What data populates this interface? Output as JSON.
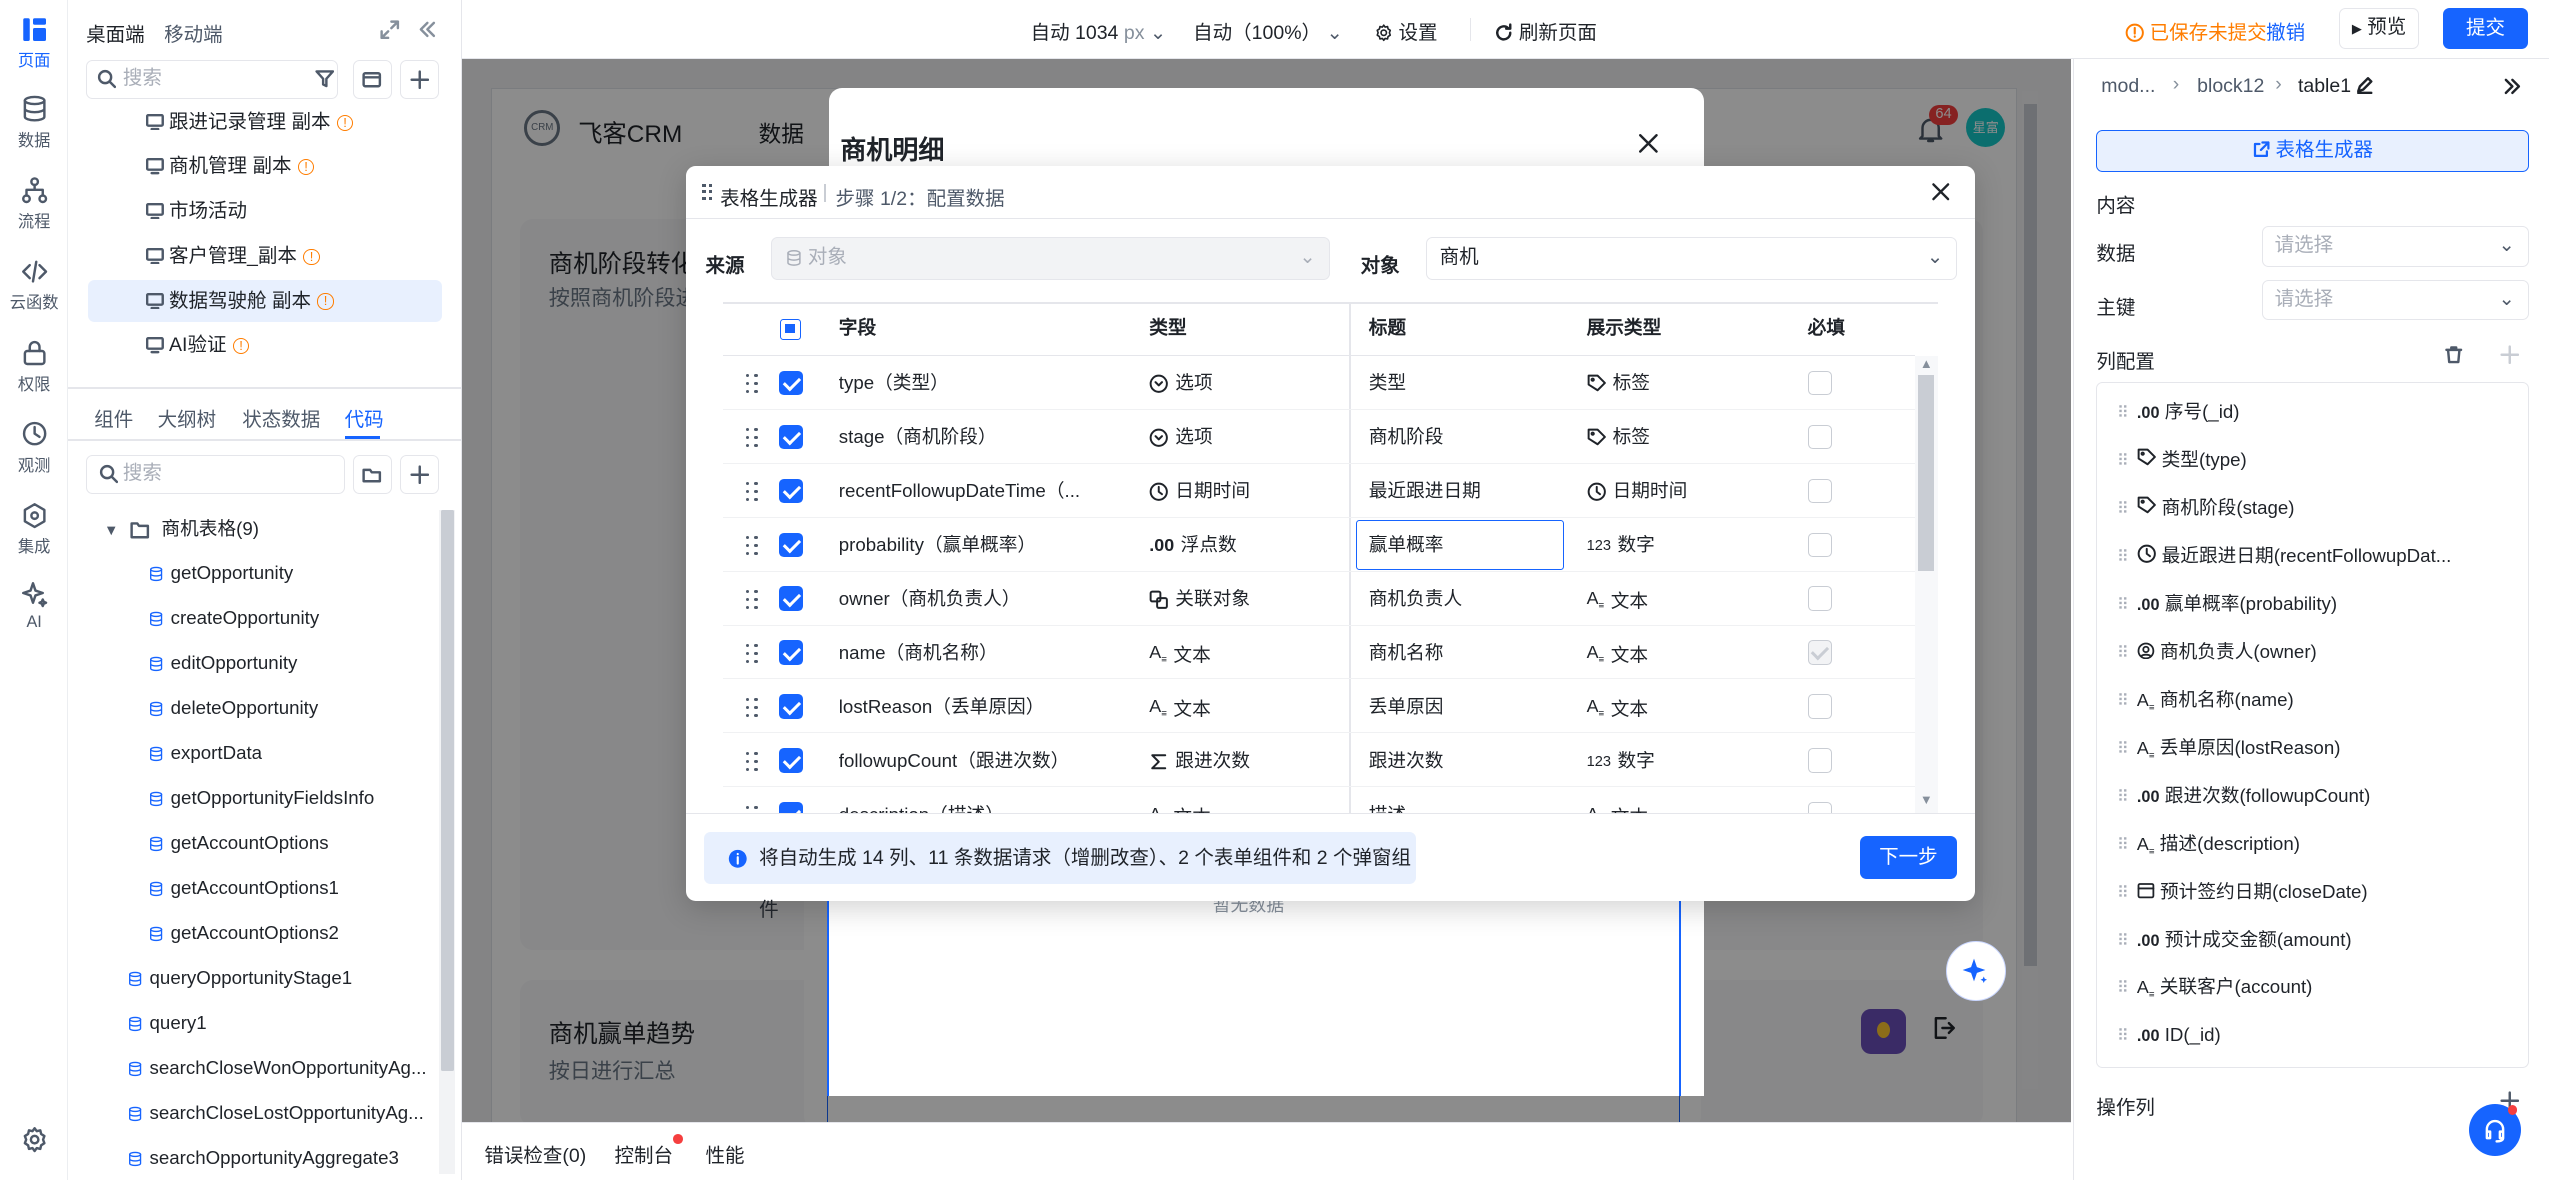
{
  "rail": {
    "items": [
      {
        "label": "页面",
        "icon": "page-icon"
      },
      {
        "label": "数据",
        "icon": "database-icon"
      },
      {
        "label": "流程",
        "icon": "flow-icon"
      },
      {
        "label": "云函数",
        "icon": "code-icon"
      },
      {
        "label": "权限",
        "icon": "lock-icon"
      },
      {
        "label": "观测",
        "icon": "monitor-icon"
      },
      {
        "label": "集成",
        "icon": "integration-icon"
      },
      {
        "label": "AI",
        "icon": "sparkle-icon"
      }
    ]
  },
  "left": {
    "tab_desktop": "桌面端",
    "tab_mobile": "移动端",
    "search_placeholder": "搜索",
    "pages": [
      {
        "label": "跟进记录管理 副本",
        "warn": true
      },
      {
        "label": "商机管理 副本",
        "warn": true
      },
      {
        "label": "市场活动",
        "warn": false
      },
      {
        "label": "客户管理_副本",
        "warn": true
      },
      {
        "label": "数据驾驶舱 副本",
        "warn": true
      },
      {
        "label": "AI验证",
        "warn": true
      }
    ],
    "subtabs": [
      "组件",
      "大纲树",
      "状态数据",
      "代码"
    ],
    "code_search_placeholder": "搜索",
    "folder": "商机表格(9)",
    "apis_nested": [
      "getOpportunity",
      "createOpportunity",
      "editOpportunity",
      "deleteOpportunity",
      "exportData",
      "getOpportunityFieldsInfo",
      "getAccountOptions",
      "getAccountOptions1",
      "getAccountOptions2"
    ],
    "apis_top": [
      "queryOpportunityStage1",
      "query1",
      "searchCloseWonOpportunityAg...",
      "searchCloseLostOpportunityAg...",
      "searchOpportunityAggregate3"
    ]
  },
  "topbar": {
    "width_label": "自动 1034",
    "width_unit": "px",
    "zoom_label": "自动（100%）",
    "settings": "设置",
    "refresh": "刷新页面",
    "unsaved": "已保存未提交",
    "revoke": "撤销",
    "preview": "预览",
    "submit": "提交"
  },
  "canvas": {
    "brand": "飞客CRM",
    "nav_partial": "数据",
    "notif_count": "64",
    "avatar_text": "星富",
    "card1_title": "商机阶段转化",
    "card1_sub": "按照商机阶段进",
    "card2_title": "商机赢单趋势",
    "card2_sub": "按日进行汇总",
    "bg_dialog_title": "商机明细",
    "bg_dialog_empty": "暂无数据"
  },
  "dialog": {
    "title": "表格生成器",
    "step": "步骤 1/2：配置数据",
    "source_label": "来源",
    "source_value": "对象",
    "object_label": "对象",
    "object_value": "商机",
    "headers": {
      "field": "字段",
      "type": "类型",
      "title": "标题",
      "display": "展示类型",
      "required": "必填"
    },
    "rows": [
      {
        "field": "type（类型）",
        "type": "选项",
        "type_icon": "option-icon",
        "title": "类型",
        "display": "标签",
        "display_icon": "tag-icon",
        "required": false
      },
      {
        "field": "stage（商机阶段）",
        "type": "选项",
        "type_icon": "option-icon",
        "title": "商机阶段",
        "display": "标签",
        "display_icon": "tag-icon",
        "required": false
      },
      {
        "field": "recentFollowupDateTime（...",
        "type": "日期时间",
        "type_icon": "clock-icon",
        "title": "最近跟进日期",
        "display": "日期时间",
        "display_icon": "clock-icon",
        "required": false
      },
      {
        "field": "probability（赢单概率）",
        "type": "浮点数",
        "type_icon": "decimal-icon",
        "title": "赢单概率",
        "display": "数字",
        "display_icon": "number-icon",
        "required": false
      },
      {
        "field": "owner（商机负责人）",
        "type": "关联对象",
        "type_icon": "relation-icon",
        "title": "商机负责人",
        "display": "文本",
        "display_icon": "text-icon",
        "required": false
      },
      {
        "field": "name（商机名称）",
        "type": "文本",
        "type_icon": "text-icon",
        "title": "商机名称",
        "display": "文本",
        "display_icon": "text-icon",
        "required": true
      },
      {
        "field": "lostReason（丢单原因）",
        "type": "文本",
        "type_icon": "text-icon",
        "title": "丢单原因",
        "display": "文本",
        "display_icon": "text-icon",
        "required": false
      },
      {
        "field": "followupCount（跟进次数）",
        "type": "跟进次数",
        "type_icon": "sum-icon",
        "title": "跟进次数",
        "display": "数字",
        "display_icon": "number-icon",
        "required": false
      },
      {
        "field": "description（描述）",
        "type": "文本",
        "type_icon": "text-icon",
        "title": "描述",
        "display": "文本",
        "display_icon": "text-icon",
        "required": false
      }
    ],
    "info": "将自动生成 14 列、11 条数据请求（增删改查）、2 个表单组件和 2 个弹窗组件",
    "next": "下一步"
  },
  "right": {
    "breadcrumb": [
      "mod...",
      "block12",
      "table1"
    ],
    "generator_btn": "表格生成器",
    "content_label": "内容",
    "data_label": "数据",
    "data_placeholder": "请选择",
    "key_label": "主键",
    "key_placeholder": "请选择",
    "columns_label": "列配置",
    "columns": [
      {
        "icon": ".00",
        "label": "序号(_id)"
      },
      {
        "icon": "tag",
        "label": "类型(type)"
      },
      {
        "icon": "tag",
        "label": "商机阶段(stage)"
      },
      {
        "icon": "clock",
        "label": "最近跟进日期(recentFollowupDat..."
      },
      {
        "icon": ".00",
        "label": "赢单概率(probability)"
      },
      {
        "icon": "user",
        "label": "商机负责人(owner)"
      },
      {
        "icon": "text",
        "label": "商机名称(name)"
      },
      {
        "icon": "text",
        "label": "丢单原因(lostReason)"
      },
      {
        "icon": ".00",
        "label": "跟进次数(followupCount)"
      },
      {
        "icon": "text",
        "label": "描述(description)"
      },
      {
        "icon": "calendar",
        "label": "预计签约日期(closeDate)"
      },
      {
        "icon": ".00",
        "label": "预计成交金额(amount)"
      },
      {
        "icon": "text",
        "label": "关联客户(account)"
      },
      {
        "icon": ".00",
        "label": "ID(_id)"
      }
    ],
    "ops_label": "操作列"
  },
  "bottom": {
    "errors": "错误检查(0)",
    "console": "控制台",
    "perf": "性能"
  },
  "colors": {
    "accent": "#1664ff",
    "warning": "#ff7d00",
    "danger": "#f53f3f"
  }
}
